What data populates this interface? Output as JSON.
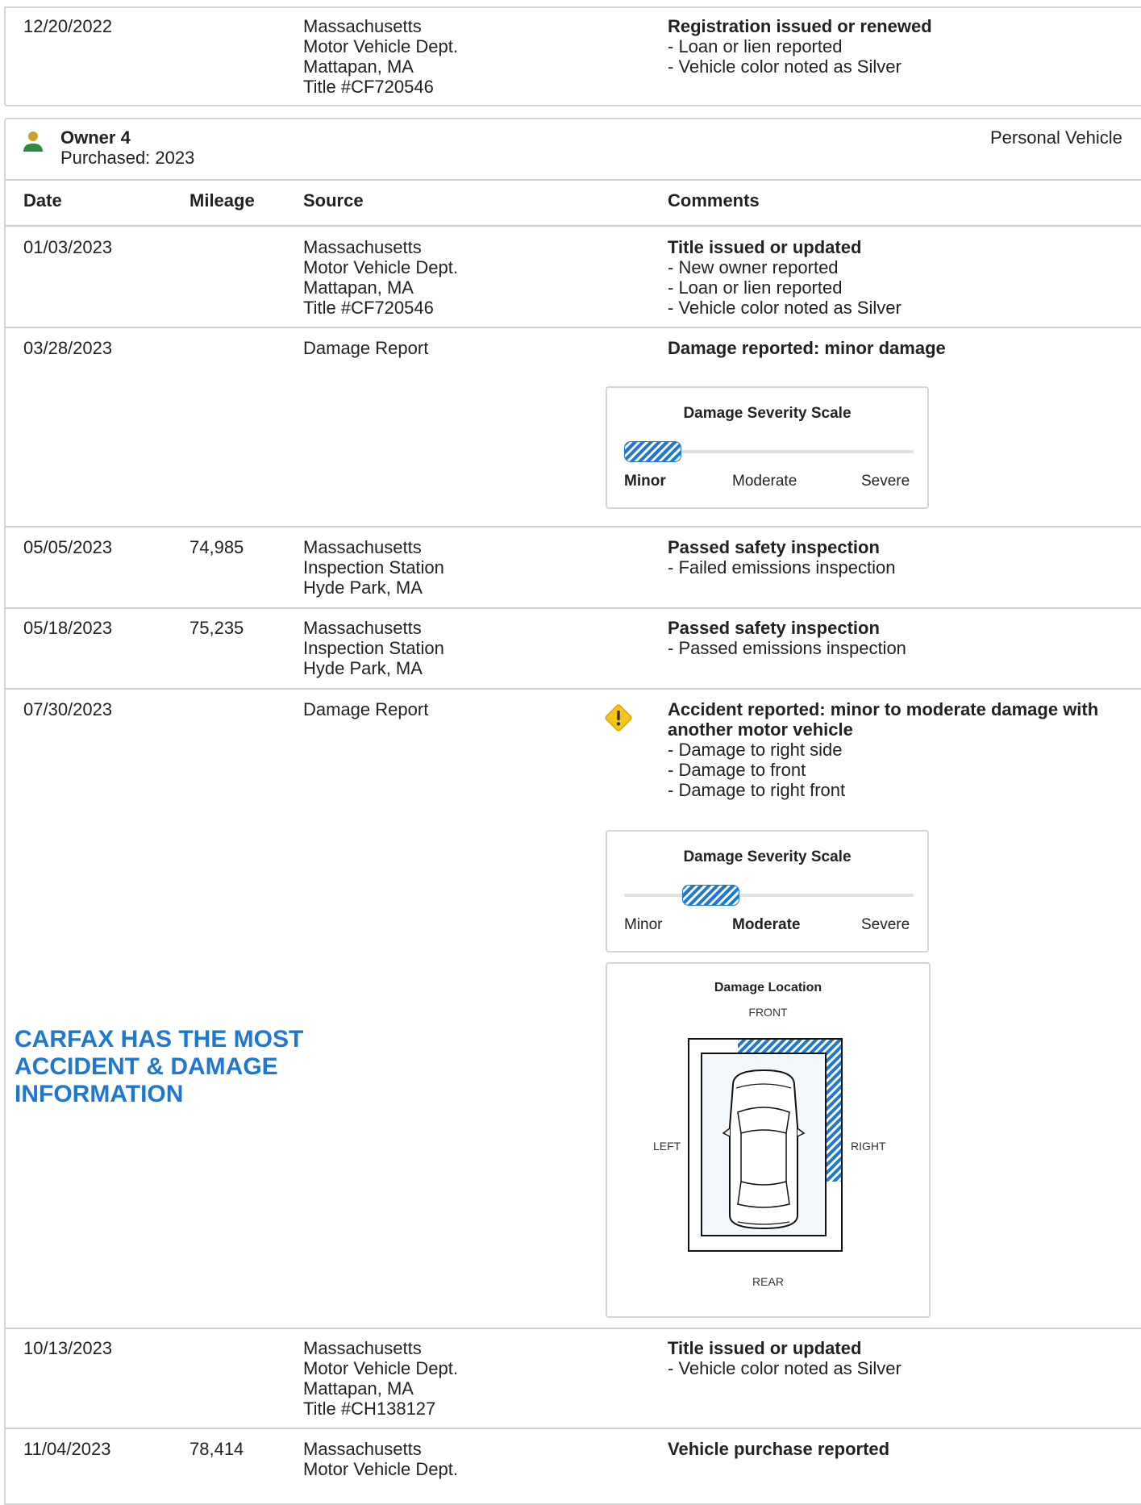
{
  "top_row": {
    "date": "12/20/2022",
    "source": [
      "Massachusetts",
      "Motor Vehicle Dept.",
      "Mattapan, MA",
      "Title #CF720546"
    ],
    "comment_title": "Registration issued or renewed",
    "comments": [
      "- Loan or lien reported",
      "- Vehicle color noted as Silver"
    ]
  },
  "owner": {
    "name": "Owner 4",
    "purchased": "Purchased: 2023",
    "type": "Personal Vehicle"
  },
  "headers": {
    "date": "Date",
    "mileage": "Mileage",
    "source": "Source",
    "comments": "Comments"
  },
  "rows": [
    {
      "date": "01/03/2023",
      "mileage": "",
      "source": [
        "Massachusetts",
        "Motor Vehicle Dept.",
        "Mattapan, MA",
        "Title #CF720546"
      ],
      "comment_title": "Title issued or updated",
      "comments": [
        "- New owner reported",
        "- Loan or lien reported",
        "- Vehicle color noted as Silver"
      ]
    },
    {
      "date": "03/28/2023",
      "mileage": "",
      "source": [
        "Damage Report"
      ],
      "comment_title": "Damage reported: minor damage",
      "comments": [],
      "severity": {
        "title": "Damage Severity Scale",
        "labels": [
          "Minor",
          "Moderate",
          "Severe"
        ],
        "level": "Minor"
      }
    },
    {
      "date": "05/05/2023",
      "mileage": "74,985",
      "source": [
        "Massachusetts",
        "Inspection Station",
        "Hyde Park, MA"
      ],
      "comment_title": "Passed safety inspection",
      "comments": [
        "- Failed emissions inspection"
      ]
    },
    {
      "date": "05/18/2023",
      "mileage": "75,235",
      "source": [
        "Massachusetts",
        "Inspection Station",
        "Hyde Park, MA"
      ],
      "comment_title": "Passed safety inspection",
      "comments": [
        "- Passed emissions inspection"
      ]
    },
    {
      "date": "07/30/2023",
      "mileage": "",
      "source": [
        "Damage Report"
      ],
      "comment_title": [
        "Accident reported: minor to moderate damage with",
        "another motor vehicle"
      ],
      "comments": [
        "- Damage to right side",
        "- Damage to front",
        "- Damage to right front"
      ],
      "severity": {
        "title": "Damage Severity Scale",
        "labels": [
          "Minor",
          "Moderate",
          "Severe"
        ],
        "level": "Moderate"
      },
      "location": {
        "title": "Damage Location",
        "front": "FRONT",
        "rear": "REAR",
        "left": "LEFT",
        "right": "RIGHT",
        "damaged_areas": [
          "front",
          "right side",
          "right front"
        ]
      }
    },
    {
      "date": "10/13/2023",
      "mileage": "",
      "source": [
        "Massachusetts",
        "Motor Vehicle Dept.",
        "Mattapan, MA",
        "Title #CH138127"
      ],
      "comment_title": "Title issued or updated",
      "comments": [
        "- Vehicle color noted as Silver"
      ]
    },
    {
      "date": "11/04/2023",
      "mileage": "78,414",
      "source": [
        "Massachusetts",
        "Motor Vehicle Dept."
      ],
      "comment_title": "Vehicle purchase reported",
      "comments": []
    }
  ],
  "promo": [
    "CARFAX HAS THE MOST",
    "ACCIDENT & DAMAGE",
    "INFORMATION"
  ],
  "colors": {
    "accent": "#1d78d2",
    "warning": "#f5c518",
    "owner_icon_head": "#c9a227",
    "owner_icon_body": "#2e8b3d"
  }
}
